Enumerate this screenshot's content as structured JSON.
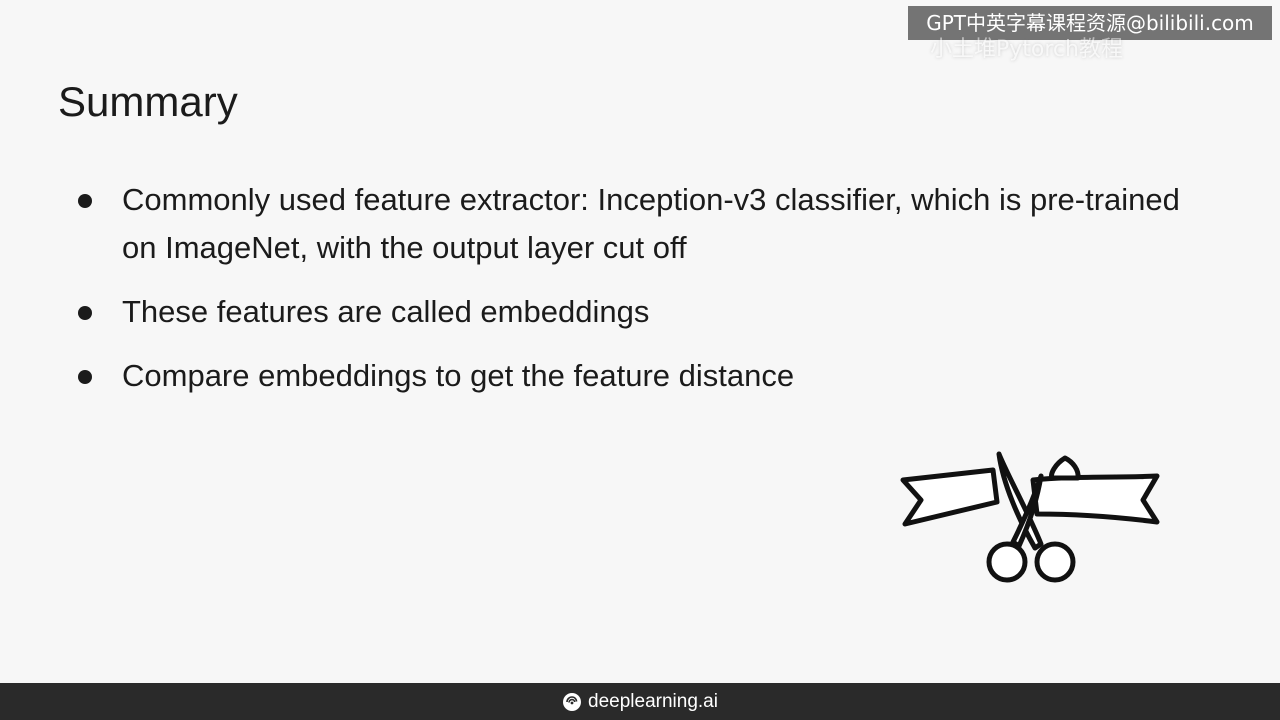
{
  "watermark": {
    "line1": "GPT中英字幕课程资源@bilibili.com",
    "line2": "小土堆Pytorch教程"
  },
  "slide": {
    "title": "Summary",
    "bullets": [
      {
        "text": "Commonly used feature extractor: Inception-v3 classifier, which is pre-trained on ImageNet, with the output layer cut off"
      },
      {
        "text": "These features are called embeddings"
      },
      {
        "text": "Compare embeddings to get the feature distance"
      }
    ],
    "illustration": "scissors-cutting-ribbon-icon"
  },
  "footer": {
    "brand": "deeplearning.ai",
    "logo_icon": "deeplearning-logo-icon"
  },
  "colors": {
    "background": "#f7f7f7",
    "text": "#1b1b1b",
    "footer": "#2a2a2a"
  }
}
